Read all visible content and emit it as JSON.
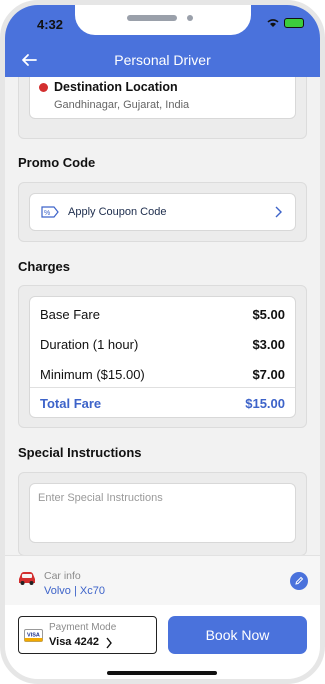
{
  "status_bar": {
    "time": "4:32"
  },
  "app_bar": {
    "title": "Personal Driver",
    "back_icon": "arrow-left-icon"
  },
  "destination": {
    "title": "Destination Location",
    "address": "Gandhinagar, Gujarat, India",
    "dot_color": "#d32f2f"
  },
  "promo": {
    "section_title": "Promo Code",
    "coupon_label": "Apply Coupon Code",
    "icon": "coupon-tag-icon"
  },
  "charges": {
    "section_title": "Charges",
    "rows": [
      {
        "label": "Base Fare",
        "amount": "$5.00"
      },
      {
        "label": "Duration (1 hour)",
        "amount": "$3.00"
      },
      {
        "label": "Minimum ($15.00)",
        "amount": "$7.00"
      }
    ],
    "total": {
      "label": "Total Fare",
      "amount": "$15.00"
    }
  },
  "instructions": {
    "section_title": "Special Instructions",
    "placeholder": "Enter Special Instructions"
  },
  "car_info": {
    "label": "Car info",
    "value": "Volvo | Xc70",
    "icon": "car-icon"
  },
  "payment": {
    "label": "Payment Mode",
    "value": "Visa 4242",
    "icon": "visa-card-icon"
  },
  "book_button": {
    "label": "Book Now"
  },
  "colors": {
    "primary": "#4a72dc",
    "accent_text": "#3d63c9",
    "background": "#f2f2f2"
  }
}
